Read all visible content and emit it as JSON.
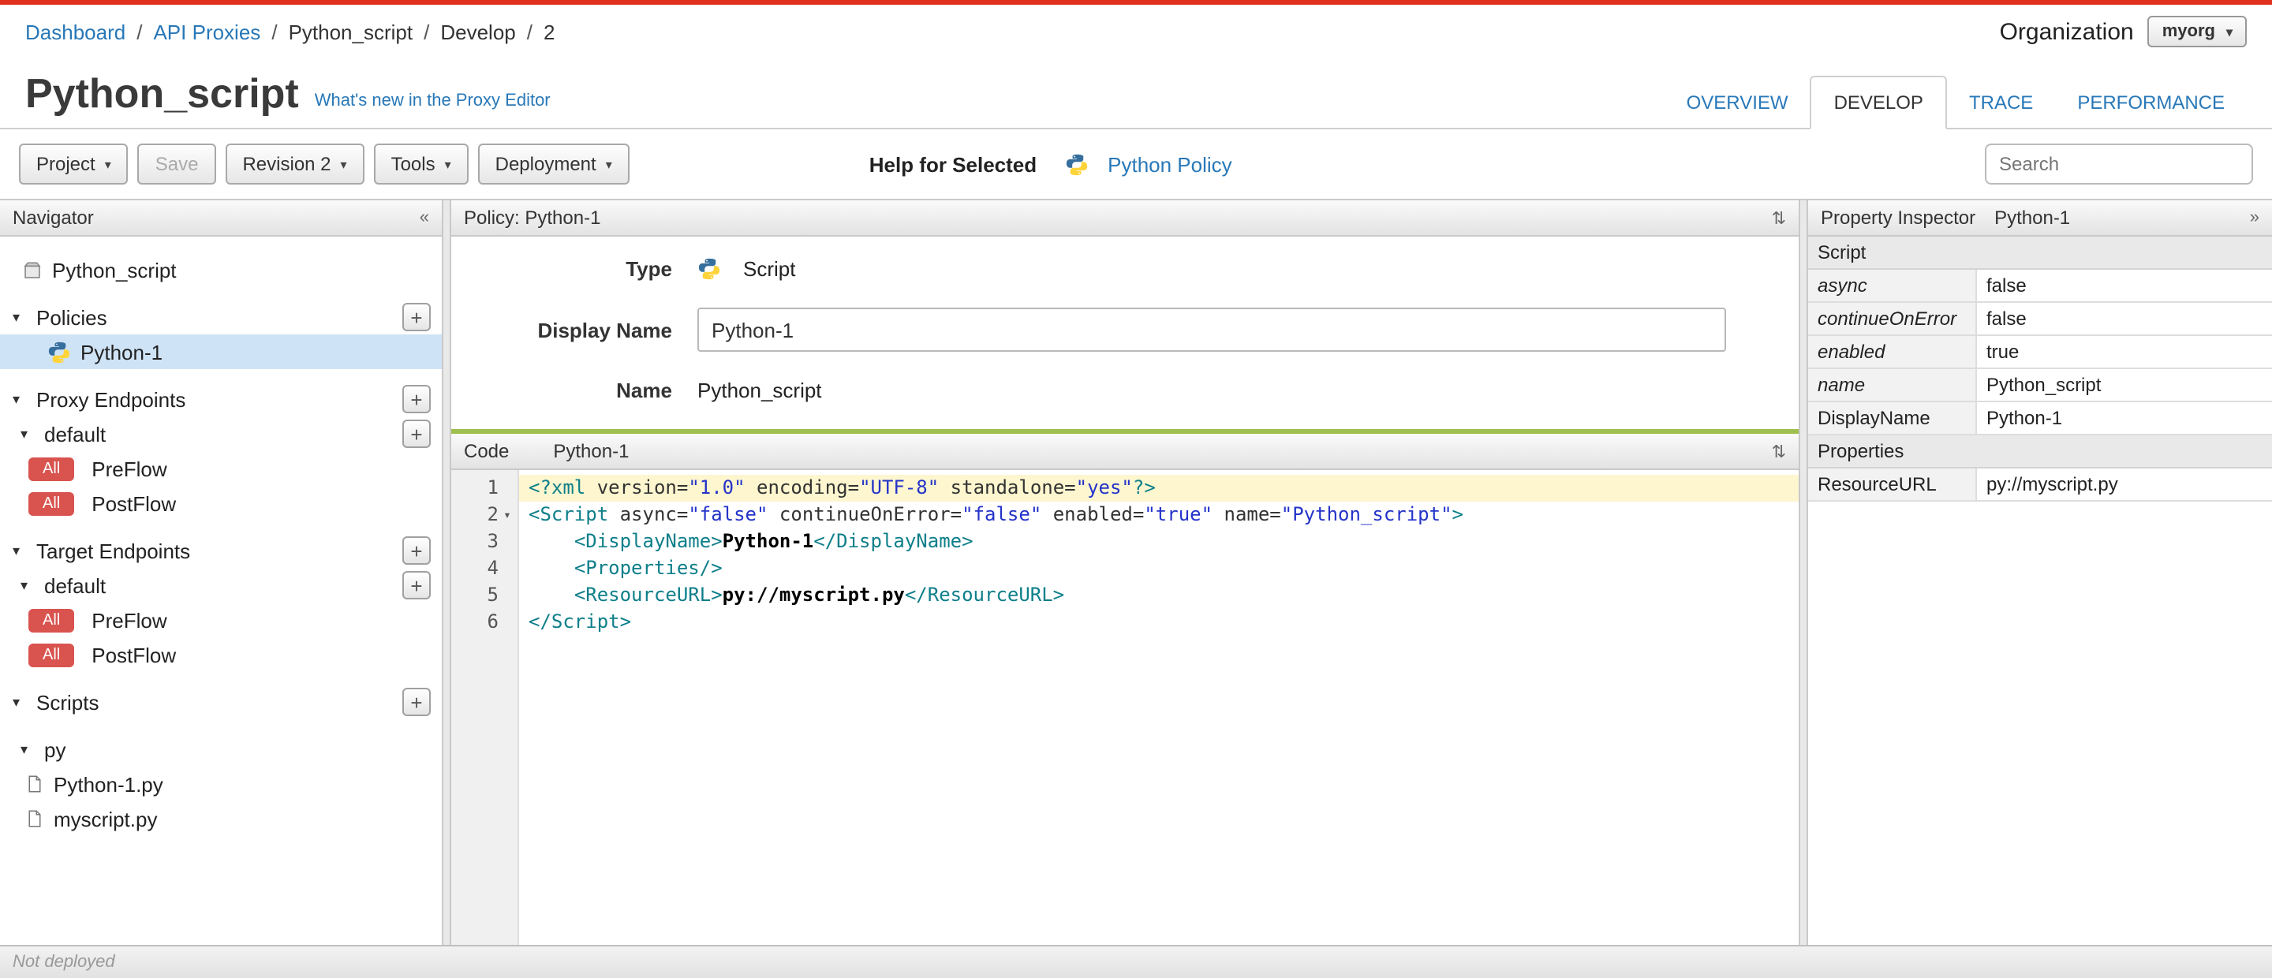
{
  "colors": {
    "top_line_red": "#e0301e",
    "link_blue": "#2878b8",
    "badge_red": "#d9534f",
    "code_divider_green": "#9fbf4e",
    "selected_row_blue": "#cfe3f6",
    "active_line_yellow": "#fdf6cf"
  },
  "icons": {
    "caret_down": "▾",
    "collapse_left": "«",
    "collapse_right": "»",
    "collapse_vertical": "⇅",
    "plus": "+"
  },
  "breadcrumb": {
    "items": [
      {
        "label": "Dashboard",
        "link": true
      },
      {
        "label": "API Proxies",
        "link": true
      },
      {
        "label": "Python_script",
        "link": false
      },
      {
        "label": "Develop",
        "link": false
      },
      {
        "label": "2",
        "link": false
      }
    ]
  },
  "org": {
    "label": "Organization",
    "value": "myorg"
  },
  "header": {
    "title": "Python_script",
    "whats_new": "What's new in the Proxy Editor"
  },
  "tabs": [
    {
      "label": "OVERVIEW",
      "active": false
    },
    {
      "label": "DEVELOP",
      "active": true
    },
    {
      "label": "TRACE",
      "active": false
    },
    {
      "label": "PERFORMANCE",
      "active": false
    }
  ],
  "toolbar": {
    "project": "Project",
    "save": "Save",
    "revision": "Revision 2",
    "tools": "Tools",
    "deployment": "Deployment",
    "help_for_selected": "Help for Selected",
    "policy_link": "Python Policy",
    "search_placeholder": "Search"
  },
  "navigator": {
    "title": "Navigator",
    "items": [
      {
        "label": "Python_script",
        "icon": "proxy",
        "pad": 14,
        "gap": true
      },
      {
        "label": "Policies",
        "caret": true,
        "plus": true,
        "pad": 8,
        "gap": true
      },
      {
        "label": "Python-1",
        "icon": "python",
        "selected": true,
        "pad": 30
      },
      {
        "label": "Proxy Endpoints",
        "caret": true,
        "plus": true,
        "pad": 8,
        "gap": true
      },
      {
        "label": "default",
        "caret": true,
        "plus": true,
        "pad": 13
      },
      {
        "label": "PreFlow",
        "badge": "All",
        "pad": 18
      },
      {
        "label": "PostFlow",
        "badge": "All",
        "pad": 18
      },
      {
        "label": "Target Endpoints",
        "caret": true,
        "plus": true,
        "pad": 8,
        "gap": true
      },
      {
        "label": "default",
        "caret": true,
        "plus": true,
        "pad": 13
      },
      {
        "label": "PreFlow",
        "badge": "All",
        "pad": 18
      },
      {
        "label": "PostFlow",
        "badge": "All",
        "pad": 18
      },
      {
        "label": "Scripts",
        "caret": true,
        "plus": true,
        "pad": 8,
        "gap": true
      },
      {
        "label": "py",
        "caret": true,
        "pad": 13,
        "gap": true
      },
      {
        "label": "Python-1.py",
        "icon": "doc",
        "pad": 16
      },
      {
        "label": "myscript.py",
        "icon": "doc",
        "pad": 16
      }
    ]
  },
  "policy_panel": {
    "title": "Policy: Python-1",
    "type_label": "Type",
    "type_value": "Script",
    "display_name_label": "Display Name",
    "display_name_value": "Python-1",
    "name_label": "Name",
    "name_value": "Python_script"
  },
  "code_panel": {
    "tab": "Code",
    "title": "Python-1",
    "lines": [
      {
        "num": 1,
        "highlight": true,
        "tokens": [
          {
            "c": "tag",
            "t": "<?xml "
          },
          {
            "c": "attr",
            "t": "version="
          },
          {
            "c": "str",
            "t": "\"1.0\""
          },
          {
            "c": "attr",
            "t": " encoding="
          },
          {
            "c": "str",
            "t": "\"UTF-8\""
          },
          {
            "c": "attr",
            "t": " standalone="
          },
          {
            "c": "str",
            "t": "\"yes\""
          },
          {
            "c": "tag",
            "t": "?>"
          }
        ]
      },
      {
        "num": 2,
        "fold": true,
        "tokens": [
          {
            "c": "tag",
            "t": "<Script "
          },
          {
            "c": "attr",
            "t": "async="
          },
          {
            "c": "str",
            "t": "\"false\""
          },
          {
            "c": "attr",
            "t": " continueOnError="
          },
          {
            "c": "str",
            "t": "\"false\""
          },
          {
            "c": "attr",
            "t": " enabled="
          },
          {
            "c": "str",
            "t": "\"true\""
          },
          {
            "c": "attr",
            "t": " name="
          },
          {
            "c": "str",
            "t": "\"Python_script\""
          },
          {
            "c": "tag",
            "t": ">"
          }
        ]
      },
      {
        "num": 3,
        "tokens": [
          {
            "c": "plain",
            "t": "    "
          },
          {
            "c": "tag",
            "t": "<DisplayName>"
          },
          {
            "c": "text",
            "t": "Python-1"
          },
          {
            "c": "tag",
            "t": "</DisplayName>"
          }
        ]
      },
      {
        "num": 4,
        "tokens": [
          {
            "c": "plain",
            "t": "    "
          },
          {
            "c": "tag",
            "t": "<Properties/>"
          }
        ]
      },
      {
        "num": 5,
        "tokens": [
          {
            "c": "plain",
            "t": "    "
          },
          {
            "c": "tag",
            "t": "<ResourceURL>"
          },
          {
            "c": "text",
            "t": "py://myscript.py"
          },
          {
            "c": "tag",
            "t": "</ResourceURL>"
          }
        ]
      },
      {
        "num": 6,
        "tokens": [
          {
            "c": "tag",
            "t": "</Script>"
          }
        ]
      }
    ]
  },
  "inspector": {
    "title": "Property Inspector",
    "subtitle": "Python-1",
    "rows": [
      {
        "section": true,
        "label": "Script"
      },
      {
        "name": "async",
        "italic": true,
        "value": "false"
      },
      {
        "name": "continueOnError",
        "italic": true,
        "value": "false"
      },
      {
        "name": "enabled",
        "italic": true,
        "value": "true"
      },
      {
        "name": "name",
        "italic": true,
        "value": "Python_script"
      },
      {
        "name": "DisplayName",
        "italic": false,
        "value": "Python-1"
      },
      {
        "section": true,
        "label": "Properties"
      },
      {
        "name": "ResourceURL",
        "italic": false,
        "value": "py://myscript.py"
      }
    ]
  },
  "statusbar": {
    "text": "Not deployed"
  }
}
